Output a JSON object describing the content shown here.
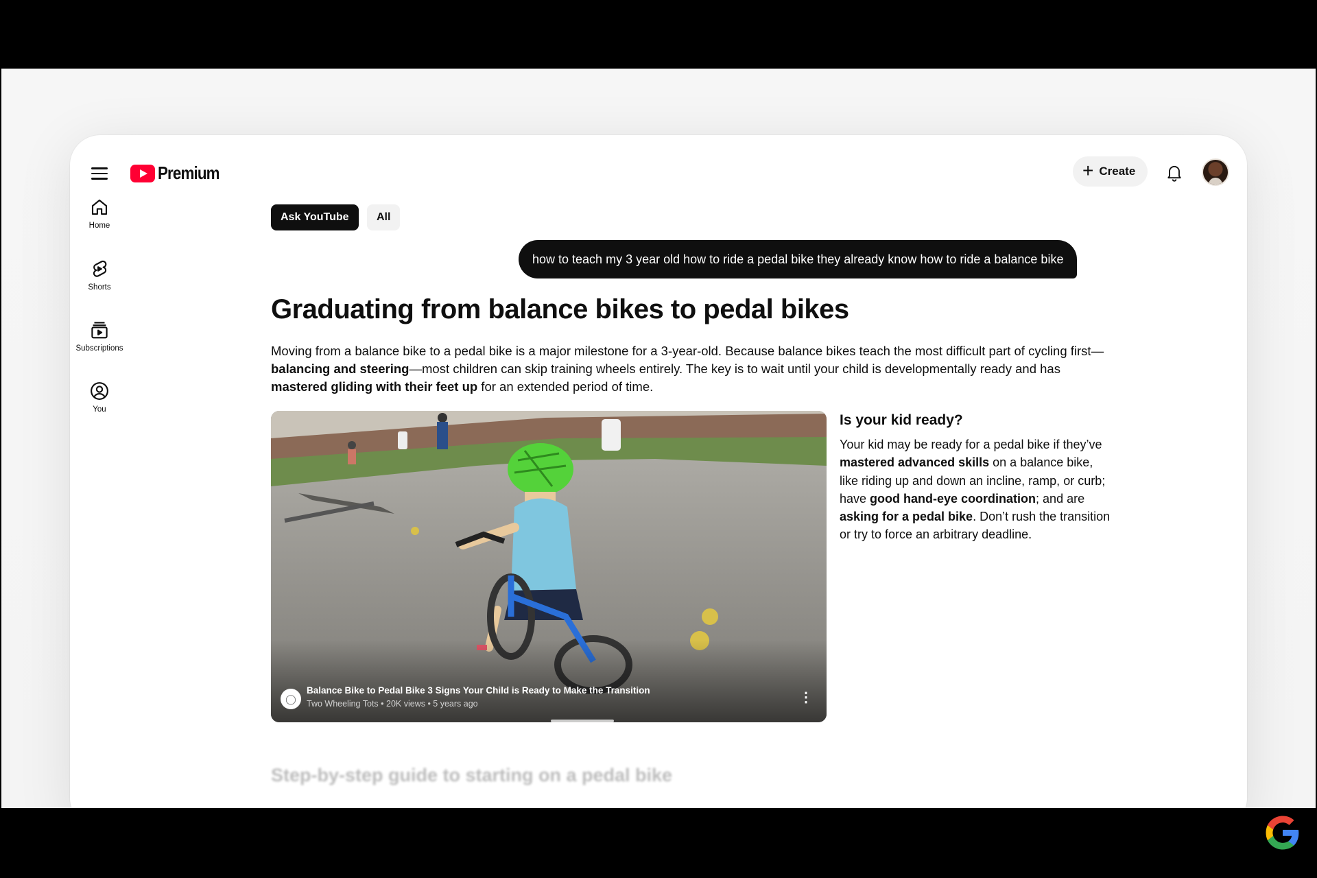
{
  "app": {
    "logo_text": "Premium"
  },
  "header": {
    "create_label": "Create"
  },
  "sidebar": {
    "items": [
      {
        "label": "Home",
        "icon": "home-icon"
      },
      {
        "label": "Shorts",
        "icon": "shorts-icon"
      },
      {
        "label": "Subscriptions",
        "icon": "subscriptions-icon"
      },
      {
        "label": "You",
        "icon": "you-icon"
      }
    ]
  },
  "chips": {
    "ask": "Ask YouTube",
    "all": "All"
  },
  "query": "how to teach my 3 year old how to ride a pedal bike they already know how to ride a balance bike",
  "answer": {
    "headline": "Graduating from balance bikes to pedal bikes",
    "intro": {
      "t1": "Moving from a balance bike to a pedal bike is a major milestone for a 3-year-old. Because balance bikes teach the most difficult part of cycling first—",
      "b1": "balancing and steering",
      "t2": "—most children can skip training wheels entirely. The key is to wait until your child is developmentally ready and has ",
      "b2": "mastered gliding with their feet up",
      "t3": " for an extended period of time."
    },
    "video": {
      "title": "Balance Bike to Pedal Bike 3 Signs Your Child is Ready to Make the Transition",
      "meta": "Two Wheeling Tots • 20K views • 5 years ago"
    },
    "ready": {
      "heading": "Is your kid ready?",
      "t1": "Your kid may be ready for a pedal bike if they’ve ",
      "b1": "mastered advanced skills",
      "t2": " on a balance bike, like riding up and down an incline, ramp, or curb; have ",
      "b2": "good hand-eye coordination",
      "t3": "; and are ",
      "b3": "asking for a pedal bike",
      "t4": ". Don’t rush the transition or try to force an arbitrary deadline."
    },
    "next_heading": "Step-by-step guide to starting on a pedal bike"
  },
  "colors": {
    "brand_red": "#ff0033",
    "text": "#0f0f0f",
    "chip_bg": "#f2f2f2"
  }
}
